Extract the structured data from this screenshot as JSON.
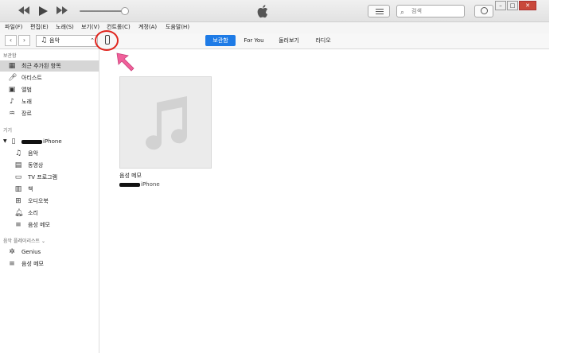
{
  "menu": [
    {
      "label": "파일(F)"
    },
    {
      "label": "편집(E)"
    },
    {
      "label": "노래(S)"
    },
    {
      "label": "보기(V)"
    },
    {
      "label": "컨트롤(C)"
    },
    {
      "label": "계정(A)"
    },
    {
      "label": "도움말(H)"
    }
  ],
  "search": {
    "placeholder": "검색"
  },
  "media_select": {
    "label": "음악"
  },
  "tabs": [
    {
      "label": "보관함",
      "active": true
    },
    {
      "label": "For You"
    },
    {
      "label": "둘러보기"
    },
    {
      "label": "라디오"
    }
  ],
  "sidebar": {
    "library_title": "보관함",
    "library": [
      {
        "label": "최근 추가된 항목",
        "icon": "grid-icon",
        "selected": true
      },
      {
        "label": "아티스트",
        "icon": "microphone-icon"
      },
      {
        "label": "앨범",
        "icon": "album-icon"
      },
      {
        "label": "노래",
        "icon": "music-note-icon"
      },
      {
        "label": "장르",
        "icon": "genre-icon"
      }
    ],
    "devices_title": "기기",
    "device_name": "iPhone",
    "device_items": [
      {
        "label": "음악",
        "icon": "music-icon"
      },
      {
        "label": "동영상",
        "icon": "film-icon"
      },
      {
        "label": "TV 프로그램",
        "icon": "tv-icon"
      },
      {
        "label": "책",
        "icon": "book-icon"
      },
      {
        "label": "오디오북",
        "icon": "audiobook-icon"
      },
      {
        "label": "소리",
        "icon": "bell-icon"
      },
      {
        "label": "음성 메모",
        "icon": "playlist-icon"
      }
    ],
    "playlists_title": "음악 플레이리스트 ⌄",
    "playlists": [
      {
        "label": "Genius",
        "icon": "genius-icon"
      },
      {
        "label": "음성 메모",
        "icon": "playlist-icon"
      }
    ]
  },
  "content": {
    "item_title": "음성 메모",
    "item_subtitle": "iPhone"
  },
  "colors": {
    "accent": "#1e7be6",
    "highlight_circle": "#e0261f",
    "arrow": "#f0609a"
  }
}
